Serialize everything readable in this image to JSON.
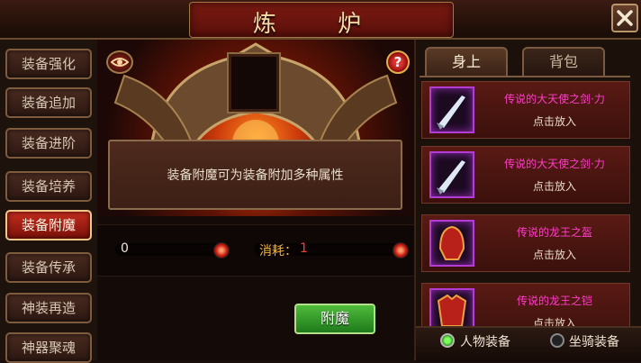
{
  "window": {
    "title": "炼 炉",
    "close_icon": "close-icon"
  },
  "left_menu": {
    "items": [
      {
        "label": "装备强化",
        "active": false
      },
      {
        "label": "装备追加",
        "active": false
      },
      {
        "label": "装备进阶",
        "active": false
      },
      {
        "label": "装备培养",
        "active": false
      },
      {
        "label": "装备附魔",
        "active": true
      },
      {
        "label": "装备传承",
        "active": false
      },
      {
        "label": "神装再造",
        "active": false
      },
      {
        "label": "神器聚魂",
        "active": false
      }
    ]
  },
  "center": {
    "info_text": "装备附魔可为装备附加多种属性",
    "left_value": "0",
    "cost_label": "消耗：",
    "cost_value": "1",
    "enchant_button": "附魔",
    "help_label": "?"
  },
  "right": {
    "tabs": [
      {
        "label": "身上",
        "active": true
      },
      {
        "label": "背包",
        "active": false
      }
    ],
    "items": [
      {
        "name": "传说的大天使之剑·力",
        "action": "点击放入",
        "icon": "sword-icon"
      },
      {
        "name": "传说的大天使之剑·力",
        "action": "点击放入",
        "icon": "sword-icon"
      },
      {
        "name": "传说的龙王之盔",
        "action": "点击放入",
        "icon": "helmet-icon"
      },
      {
        "name": "传说的龙王之铠",
        "action": "点击放入",
        "icon": "armor-icon"
      }
    ],
    "filters": [
      {
        "label": "人物装备",
        "selected": true
      },
      {
        "label": "坐骑装备",
        "selected": false
      }
    ]
  },
  "colors": {
    "item_name": "#ff3dc8",
    "active_menu": "#c32d1e",
    "enchant_button": "#3a9c2c",
    "cost_value": "#ff3b3b",
    "cost_label": "#ffb52e"
  }
}
